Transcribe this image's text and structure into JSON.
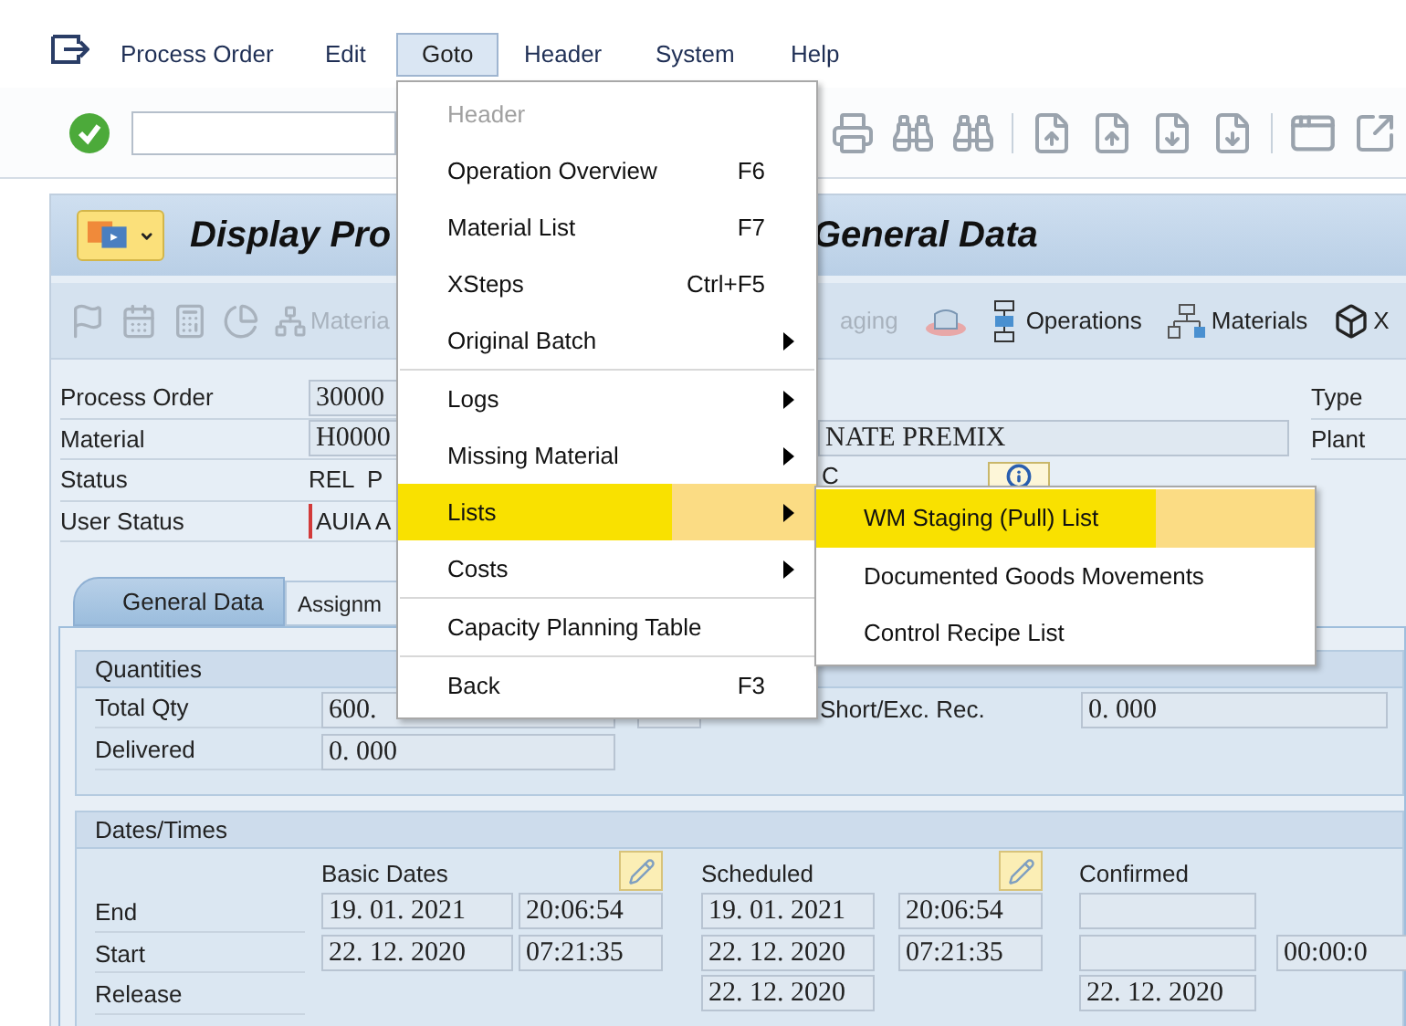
{
  "menu_bar": [
    {
      "label": "Process Order",
      "selected": false
    },
    {
      "label": "Edit",
      "selected": false
    },
    {
      "label": "Goto",
      "selected": true
    },
    {
      "label": "Header",
      "selected": false
    },
    {
      "label": "System",
      "selected": false
    },
    {
      "label": "Help",
      "selected": false
    }
  ],
  "title": {
    "left": "Display Pro",
    "right": "General Data"
  },
  "app_toolbar": {
    "left": [
      {
        "label": "Materia",
        "disabled": true
      }
    ],
    "right": [
      {
        "kind": "text",
        "label": "aging",
        "disabled": true
      },
      {
        "kind": "hat",
        "disabled": false
      },
      {
        "kind": "operations",
        "label": "Operations",
        "disabled": false
      },
      {
        "kind": "materials",
        "label": "Materials",
        "disabled": false
      },
      {
        "kind": "cube",
        "label": "X",
        "disabled": false
      }
    ]
  },
  "header_fields": [
    {
      "kind": "field",
      "label": "Process Order",
      "value": "30000"
    },
    {
      "kind": "field",
      "label": "Material",
      "value": "H0000"
    },
    {
      "kind": "text",
      "label": "Status",
      "value": "REL  P"
    },
    {
      "kind": "flagged",
      "label": "User Status",
      "value": "AUIA A"
    }
  ],
  "material_description": "NATE PREMIX",
  "status_fragment": "C",
  "right_labels": [
    "Type",
    "Plant"
  ],
  "tabs": [
    {
      "label": "General Data",
      "selected": true
    },
    {
      "label": "Assignm",
      "selected": false
    }
  ],
  "quantities": {
    "title": "Quantities",
    "rows": [
      {
        "label": "Total Qty",
        "value": "600."
      },
      {
        "label": "Delivered",
        "value": "0. 000"
      }
    ],
    "short_exc": {
      "label": "Short/Exc. Rec.",
      "value": "0. 000"
    }
  },
  "dates": {
    "title": "Dates/Times",
    "columns": [
      "Basic Dates",
      "",
      "Scheduled",
      "",
      "Confirmed",
      ""
    ],
    "rows": [
      {
        "label": "End",
        "cells": [
          "19. 01. 2021",
          "20:06:54",
          "19. 01. 2021",
          "20:06:54",
          "",
          null
        ]
      },
      {
        "label": "Start",
        "cells": [
          "22. 12. 2020",
          "07:21:35",
          "22. 12. 2020",
          "07:21:35",
          "",
          "00:00:0"
        ]
      },
      {
        "label": "Release",
        "cells": [
          null,
          null,
          "22. 12. 2020",
          null,
          "22. 12. 2020",
          null
        ]
      }
    ]
  },
  "goto_menu": [
    {
      "label": "Header",
      "disabled": true,
      "selected": false
    },
    {
      "label": "Operation Overview",
      "shortcut": "F6",
      "disabled": false,
      "selected": false
    },
    {
      "label": "Material List",
      "shortcut": "F7",
      "disabled": false,
      "selected": false
    },
    {
      "label": "XSteps",
      "shortcut": "Ctrl+F5",
      "disabled": false,
      "selected": false
    },
    {
      "label": "Original Batch",
      "submenu": true,
      "disabled": false,
      "selected": false
    },
    {
      "label": "Logs",
      "submenu": true,
      "disabled": false,
      "selected": false,
      "separator_before": true
    },
    {
      "label": "Missing Material",
      "submenu": true,
      "disabled": false,
      "selected": false
    },
    {
      "label": "Lists",
      "submenu": true,
      "disabled": false,
      "selected": true
    },
    {
      "label": "Costs",
      "submenu": true,
      "disabled": false,
      "selected": false
    },
    {
      "label": "Capacity Planning Table",
      "disabled": false,
      "selected": false,
      "separator_before": true
    },
    {
      "label": "Back",
      "shortcut": "F3",
      "disabled": false,
      "selected": false,
      "separator_before": true
    }
  ],
  "lists_submenu": [
    {
      "label": "WM Staging (Pull) List",
      "selected": true
    },
    {
      "label": "Documented Goods Movements",
      "selected": false
    },
    {
      "label": "Control Recipe List",
      "selected": false
    }
  ]
}
